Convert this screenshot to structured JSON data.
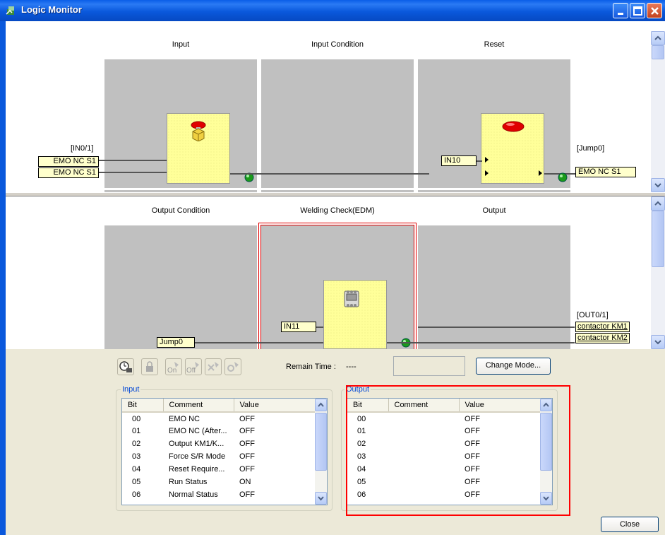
{
  "window": {
    "title": "Logic Monitor",
    "colors": {
      "titlebar": "#0a58dc",
      "block_bg": "#c0c0c0",
      "function_block": "#ffff99",
      "highlight": "#ff0000",
      "group_label": "#0046d5"
    }
  },
  "top_pane": {
    "headers": [
      "Input",
      "Input Condition",
      "Reset"
    ],
    "input_block": {
      "label": "[IN0/1]",
      "tags": [
        "EMO NC S1",
        "EMO NC S1"
      ],
      "icon": "emergency-stop-button-icon"
    },
    "reset_block": {
      "input_tag": "IN10",
      "icon": "reset-button-icon"
    },
    "output": {
      "label": "[Jump0]",
      "tag": "EMO NC S1"
    }
  },
  "bottom_pane": {
    "headers": [
      "Output Condition",
      "Welding Check(EDM)",
      "Output"
    ],
    "jump_tag": "Jump0",
    "edm_block": {
      "input_tag": "IN11",
      "icon": "contactor-icon"
    },
    "output": {
      "label": "[OUT0/1]",
      "links": [
        "contactor KM1",
        "contactor KM2"
      ]
    }
  },
  "toolbar": {
    "icons": [
      "monitor-icon",
      "lock-icon",
      "force-on-icon",
      "force-off-icon",
      "force-clear-icon",
      "force-search-icon"
    ],
    "on_text": "On",
    "off_text": "Off",
    "remain_time_label": "Remain Time :",
    "remain_time_value": "----",
    "change_mode_label": "Change Mode..."
  },
  "input_group": {
    "title": "Input",
    "columns": [
      "Bit",
      "Comment",
      "Value"
    ],
    "rows": [
      {
        "bit": "00",
        "comment": "EMO NC",
        "value": "OFF"
      },
      {
        "bit": "01",
        "comment": "EMO NC (After...",
        "value": "OFF"
      },
      {
        "bit": "02",
        "comment": "Output KM1/K...",
        "value": "OFF"
      },
      {
        "bit": "03",
        "comment": "Force S/R Mode",
        "value": "OFF"
      },
      {
        "bit": "04",
        "comment": "Reset Require...",
        "value": "OFF"
      },
      {
        "bit": "05",
        "comment": "Run Status",
        "value": "ON"
      },
      {
        "bit": "06",
        "comment": "Normal Status",
        "value": "OFF"
      }
    ]
  },
  "output_group": {
    "title": "Output",
    "columns": [
      "Bit",
      "Comment",
      "Value"
    ],
    "rows": [
      {
        "bit": "00",
        "comment": "",
        "value": "OFF"
      },
      {
        "bit": "01",
        "comment": "",
        "value": "OFF"
      },
      {
        "bit": "02",
        "comment": "",
        "value": "OFF"
      },
      {
        "bit": "03",
        "comment": "",
        "value": "OFF"
      },
      {
        "bit": "04",
        "comment": "",
        "value": "OFF"
      },
      {
        "bit": "05",
        "comment": "",
        "value": "OFF"
      },
      {
        "bit": "06",
        "comment": "",
        "value": "OFF"
      }
    ]
  },
  "close_label": "Close"
}
